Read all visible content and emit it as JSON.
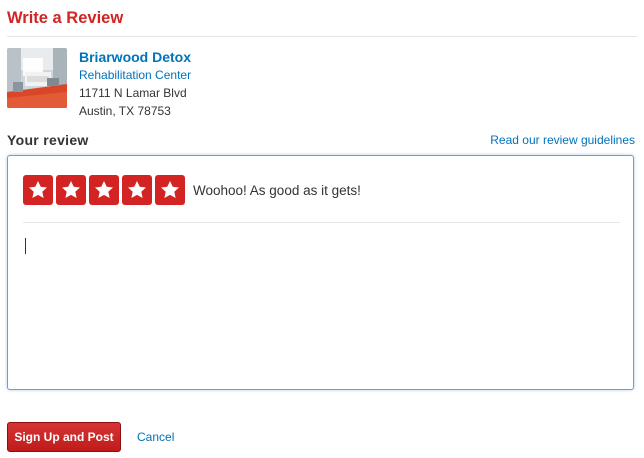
{
  "page": {
    "title": "Write a Review"
  },
  "business": {
    "name": "Briarwood Detox",
    "category": "Rehabilitation Center",
    "address_line1": "11711 N Lamar Blvd",
    "address_line2": "Austin, TX 78753",
    "photo_icon": "business-photo"
  },
  "review": {
    "section_label": "Your review",
    "guidelines_link": "Read our review guidelines",
    "rating": 5,
    "rating_max": 5,
    "rating_text": "Woohoo! As good as it gets!",
    "text_value": "",
    "star_icon": "star-icon"
  },
  "actions": {
    "submit_label": "Sign Up and Post",
    "cancel_label": "Cancel"
  },
  "colors": {
    "brand_red": "#d32323",
    "link_blue": "#0073bb",
    "text_dark": "#333333",
    "focus_border": "#6f9fcf"
  }
}
